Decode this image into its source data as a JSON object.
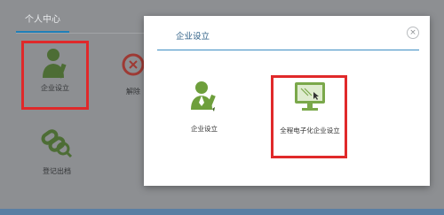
{
  "background": {
    "tab_label": "个人中心",
    "items": [
      {
        "label": "企业设立",
        "icon": "person-pen-icon"
      },
      {
        "label": "解除",
        "icon": "broken-seal-icon"
      },
      {
        "label": "登记出档",
        "icon": "chain-search-icon"
      }
    ]
  },
  "modal": {
    "title": "企业设立",
    "close_label": "×",
    "options": [
      {
        "label": "企业设立",
        "icon": "person-pen-icon"
      },
      {
        "label": "全程电子化企业设立",
        "icon": "monitor-cursor-icon"
      }
    ]
  },
  "colors": {
    "overlay": "#8f9194",
    "highlight": "#e0292a",
    "accent": "#1f7fb8",
    "icon_green": "#6e9f3c"
  }
}
